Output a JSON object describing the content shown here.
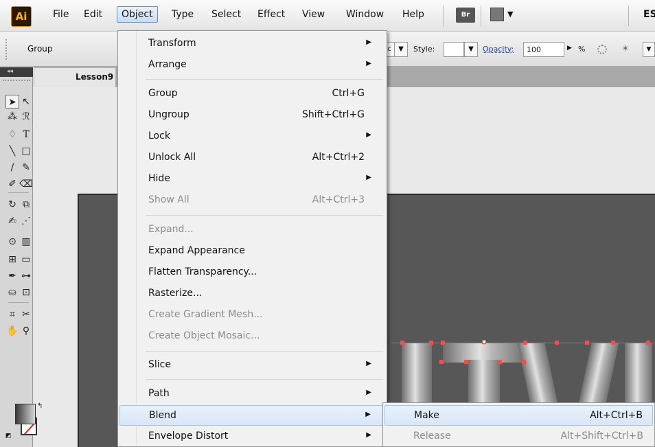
{
  "app": {
    "logo_text": "Ai"
  },
  "menubar": {
    "items": [
      "File",
      "Edit",
      "Object",
      "Type",
      "Select",
      "Effect",
      "View",
      "Window",
      "Help"
    ],
    "bridge_label": "Br",
    "right_text": "ES"
  },
  "controlbar": {
    "selection_label": "Group",
    "style_label": "Style:",
    "opacity_label": "Opacity:",
    "opacity_value": "100",
    "percent": "%"
  },
  "document": {
    "tab_label": "Lesson9"
  },
  "object_menu": {
    "items": [
      {
        "label": "Transform",
        "shortcut": "",
        "submenu": true,
        "disabled": false
      },
      {
        "label": "Arrange",
        "shortcut": "",
        "submenu": true,
        "disabled": false
      },
      {
        "label": "Group",
        "shortcut": "Ctrl+G",
        "submenu": false,
        "disabled": false
      },
      {
        "label": "Ungroup",
        "shortcut": "Shift+Ctrl+G",
        "submenu": false,
        "disabled": false
      },
      {
        "label": "Lock",
        "shortcut": "",
        "submenu": true,
        "disabled": false
      },
      {
        "label": "Unlock All",
        "shortcut": "Alt+Ctrl+2",
        "submenu": false,
        "disabled": false
      },
      {
        "label": "Hide",
        "shortcut": "",
        "submenu": true,
        "disabled": false
      },
      {
        "label": "Show All",
        "shortcut": "Alt+Ctrl+3",
        "submenu": false,
        "disabled": true
      },
      {
        "label": "Expand...",
        "shortcut": "",
        "submenu": false,
        "disabled": true
      },
      {
        "label": "Expand Appearance",
        "shortcut": "",
        "submenu": false,
        "disabled": false
      },
      {
        "label": "Flatten Transparency...",
        "shortcut": "",
        "submenu": false,
        "disabled": false
      },
      {
        "label": "Rasterize...",
        "shortcut": "",
        "submenu": false,
        "disabled": false
      },
      {
        "label": "Create Gradient Mesh...",
        "shortcut": "",
        "submenu": false,
        "disabled": true
      },
      {
        "label": "Create Object Mosaic...",
        "shortcut": "",
        "submenu": false,
        "disabled": true
      },
      {
        "label": "Slice",
        "shortcut": "",
        "submenu": true,
        "disabled": false
      },
      {
        "label": "Path",
        "shortcut": "",
        "submenu": true,
        "disabled": false
      },
      {
        "label": "Blend",
        "shortcut": "",
        "submenu": true,
        "disabled": false,
        "highlighted": true
      },
      {
        "label": "Envelope Distort",
        "shortcut": "",
        "submenu": true,
        "disabled": false
      }
    ]
  },
  "blend_submenu": {
    "items": [
      {
        "label": "Make",
        "shortcut": "Alt+Ctrl+B",
        "disabled": false,
        "highlighted": true
      },
      {
        "label": "Release",
        "shortcut": "Alt+Shift+Ctrl+B",
        "disabled": true
      }
    ]
  },
  "colors": {
    "menu_highlight": "#d7e6f6",
    "artboard": "#575757",
    "selection": "#ff4a4a",
    "logo_bg": "#2b1800",
    "logo_fg": "#ffb400"
  }
}
